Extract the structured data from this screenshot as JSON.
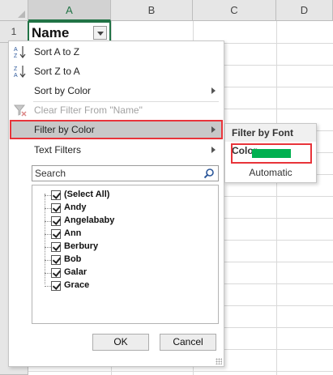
{
  "sheet": {
    "columns": [
      "A",
      "B",
      "C",
      "D"
    ],
    "rows": [
      "1"
    ],
    "cell_a1": "Name"
  },
  "menu": {
    "items": [
      {
        "label": "Sort A to Z",
        "icon": "sort-az-icon"
      },
      {
        "label": "Sort Z to A",
        "icon": "sort-za-icon"
      },
      {
        "label": "Sort by Color"
      },
      {
        "label": "Clear Filter From \"Name\"",
        "icon": "clear-filter-icon",
        "disabled": true
      },
      {
        "label": "Filter by Color",
        "highlighted": true
      },
      {
        "label": "Text Filters"
      }
    ],
    "search_placeholder": "Search",
    "list": [
      "(Select All)",
      "Andy",
      "Angelababy",
      "Ann",
      "Berbury",
      "Bob",
      "Galar",
      "Grace"
    ],
    "ok_label": "OK",
    "cancel_label": "Cancel"
  },
  "submenu": {
    "title": "Filter by Font Color",
    "swatch_color": "#00b050",
    "automatic_label": "Automatic"
  },
  "colors": {
    "excel_green": "#217346",
    "highlight_border": "#e8343a"
  }
}
